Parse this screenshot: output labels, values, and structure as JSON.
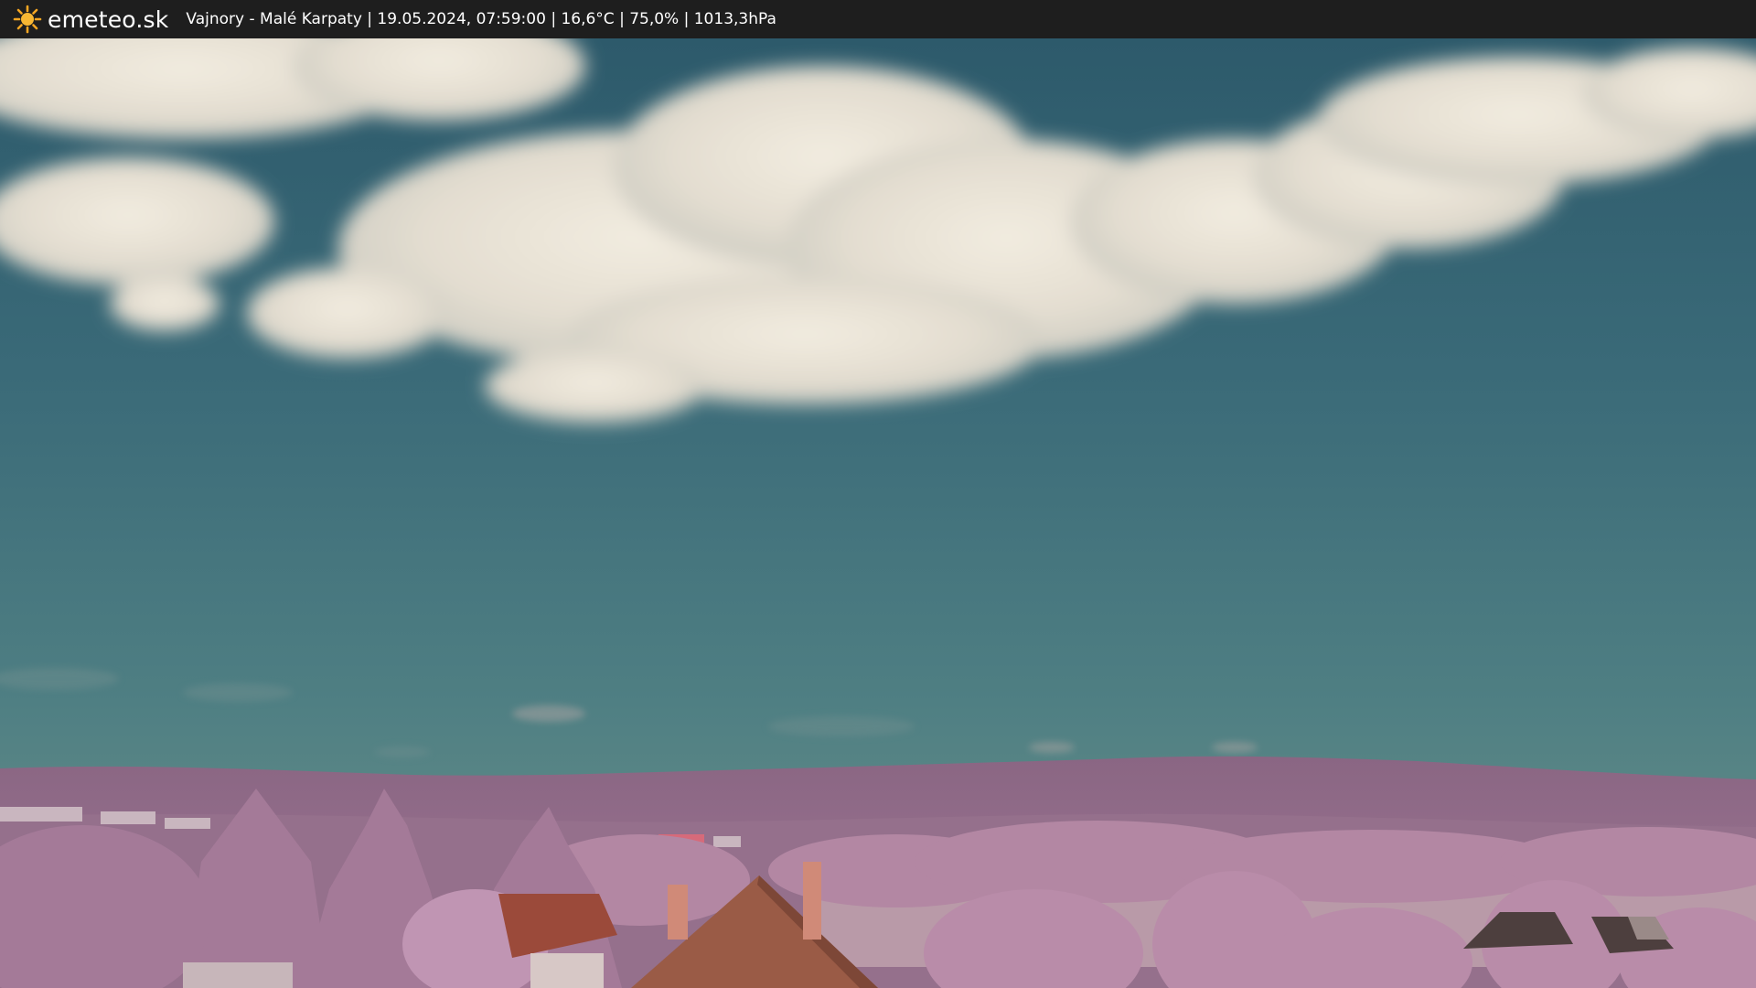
{
  "header": {
    "brand": "emeteo.sk",
    "logo_icon": "sun-icon",
    "caption": "Vajnory - Malé Karpaty | 19.05.2024, 07:59:00 | 16,6°C | 75,0% | 1013,3hPa"
  },
  "colors": {
    "bar": "#1e1e1e",
    "sun": "#f5a623",
    "sky_top": "#2f5c6c",
    "sky_horizon": "#69908a",
    "hills": "#8f6b86",
    "foliage": "#b88aa6",
    "roof": "#9b5a44"
  }
}
